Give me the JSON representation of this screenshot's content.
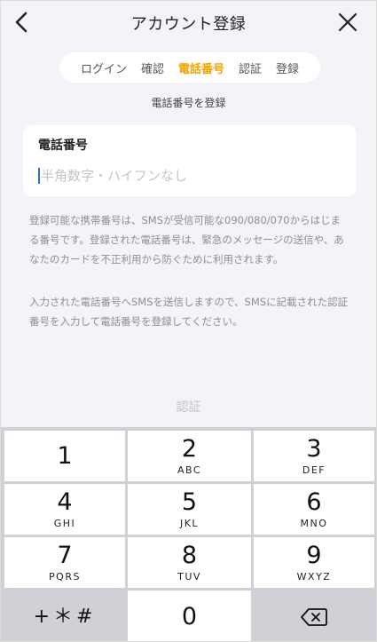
{
  "header": {
    "title": "アカウント登録"
  },
  "steps": [
    {
      "label": "ログイン",
      "active": false
    },
    {
      "label": "確認",
      "active": false
    },
    {
      "label": "電話番号",
      "active": true
    },
    {
      "label": "認証",
      "active": false
    },
    {
      "label": "登録",
      "active": false
    }
  ],
  "section_title": "電話番号を登録",
  "phone": {
    "label": "電話番号",
    "value": "",
    "placeholder": "半角数字・ハイフンなし"
  },
  "notes": [
    "登録可能な携帯番号は、SMSが受信可能な090/080/070からはじまる番号です。登録された電話番号は、緊急のメッセージの送信や、あなたのカードを不正利用から防ぐために利用されます。",
    "入力された電話番号へSMSを送信しますので、SMSに記載された認証番号を入力して電話番号を登録してください。"
  ],
  "verify_button": "認証",
  "keypad": {
    "keys": [
      {
        "num": "1",
        "sub": ""
      },
      {
        "num": "2",
        "sub": "ABC"
      },
      {
        "num": "3",
        "sub": "DEF"
      },
      {
        "num": "4",
        "sub": "GHI"
      },
      {
        "num": "5",
        "sub": "JKL"
      },
      {
        "num": "6",
        "sub": "MNO"
      },
      {
        "num": "7",
        "sub": "PQRS"
      },
      {
        "num": "8",
        "sub": "TUV"
      },
      {
        "num": "9",
        "sub": "WXYZ"
      },
      {
        "num": "+＊#",
        "sub": ""
      },
      {
        "num": "0",
        "sub": ""
      },
      {
        "num": "",
        "sub": "",
        "icon": "backspace-icon"
      }
    ]
  },
  "colors": {
    "accent": "#f0a500",
    "background": "#f3f3f8",
    "keypad_bg": "#cfd1d6"
  }
}
